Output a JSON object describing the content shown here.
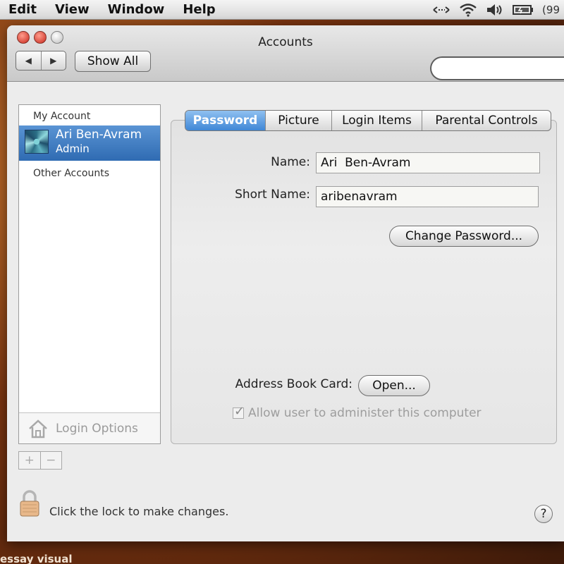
{
  "menubar": {
    "items": [
      "Edit",
      "View",
      "Window",
      "Help"
    ],
    "battery": "(99"
  },
  "window": {
    "title": "Accounts",
    "show_all": "Show All",
    "search_placeholder": ""
  },
  "sidebar": {
    "my_account_header": "My Account",
    "user_name": "Ari  Ben-Avram",
    "user_role": "Admin",
    "other_accounts_header": "Other Accounts",
    "login_options": "Login Options",
    "add": "+",
    "remove": "−"
  },
  "tabs": [
    "Password",
    "Picture",
    "Login Items",
    "Parental Controls"
  ],
  "form": {
    "name_label": "Name:",
    "name_value": "Ari  Ben-Avram",
    "short_name_label": "Short Name:",
    "short_name_value": "aribenavram",
    "change_password": "Change Password...",
    "address_book_label": "Address Book Card:",
    "open_button": "Open...",
    "allow_admin": "Allow user to administer this computer"
  },
  "footer": {
    "lock_text": "Click the lock to make changes.",
    "help": "?"
  },
  "background_text": "essay visual"
}
